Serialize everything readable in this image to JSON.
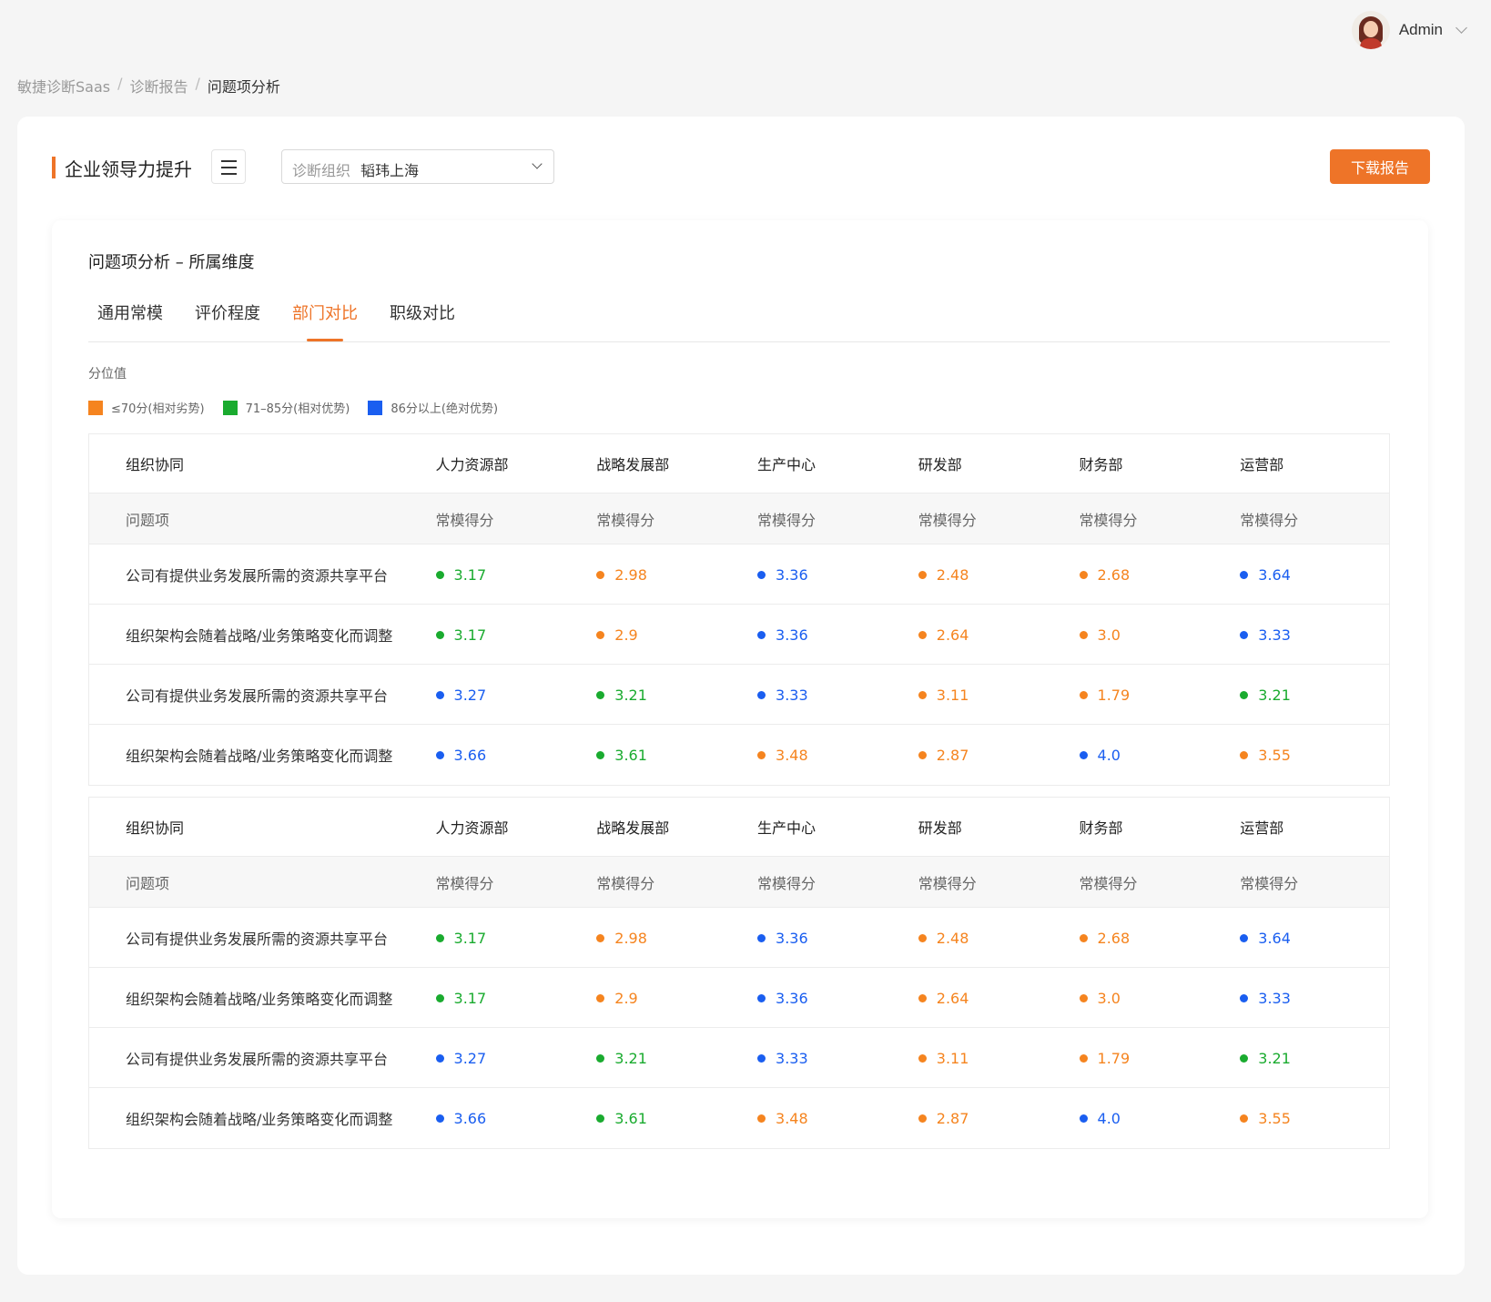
{
  "user": {
    "name": "Admin"
  },
  "breadcrumb": [
    "敏捷诊断Saas",
    "诊断报告",
    "问题项分析"
  ],
  "page": {
    "title": "企业领导力提升",
    "select_label": "诊断组织",
    "select_value": "韬玮上海",
    "download_label": "下载报告"
  },
  "section": {
    "title": "问题项分析 – 所属维度"
  },
  "tabs": [
    {
      "label": "通用常模",
      "active": false
    },
    {
      "label": "评价程度",
      "active": false
    },
    {
      "label": "部门对比",
      "active": true
    },
    {
      "label": "职级对比",
      "active": false
    }
  ],
  "legend": {
    "title": "分位值",
    "items": [
      {
        "label": "≤70分(相对劣势)",
        "color": "#f5841f"
      },
      {
        "label": "71–85分(相对优势)",
        "color": "#1aab2f"
      },
      {
        "label": "86分以上(绝对优势)",
        "color": "#1a5ef0"
      }
    ]
  },
  "colors": {
    "orange": "#f5841f",
    "green": "#1aab2f",
    "blue": "#1a5ef0",
    "accent": "#ee7428"
  },
  "tables": [
    {
      "dimension": "组织协同",
      "departments": [
        "人力资源部",
        "战略发展部",
        "生产中心",
        "研发部",
        "财务部",
        "运营部"
      ],
      "sub_first": "问题项",
      "sub_col": "常模得分",
      "rows": [
        {
          "item": "公司有提供业务发展所需的资源共享平台",
          "scores": [
            {
              "v": "3.17",
              "c": "green"
            },
            {
              "v": "2.98",
              "c": "orange"
            },
            {
              "v": "3.36",
              "c": "blue"
            },
            {
              "v": "2.48",
              "c": "orange"
            },
            {
              "v": "2.68",
              "c": "orange"
            },
            {
              "v": "3.64",
              "c": "blue"
            }
          ]
        },
        {
          "item": "组织架构会随着战略/业务策略变化而调整",
          "scores": [
            {
              "v": "3.17",
              "c": "green"
            },
            {
              "v": "2.9",
              "c": "orange"
            },
            {
              "v": "3.36",
              "c": "blue"
            },
            {
              "v": "2.64",
              "c": "orange"
            },
            {
              "v": "3.0",
              "c": "orange"
            },
            {
              "v": "3.33",
              "c": "blue"
            }
          ]
        },
        {
          "item": "公司有提供业务发展所需的资源共享平台",
          "scores": [
            {
              "v": "3.27",
              "c": "blue"
            },
            {
              "v": "3.21",
              "c": "green"
            },
            {
              "v": "3.33",
              "c": "blue"
            },
            {
              "v": "3.11",
              "c": "orange"
            },
            {
              "v": "1.79",
              "c": "orange"
            },
            {
              "v": "3.21",
              "c": "green"
            }
          ]
        },
        {
          "item": "组织架构会随着战略/业务策略变化而调整",
          "scores": [
            {
              "v": "3.66",
              "c": "blue"
            },
            {
              "v": "3.61",
              "c": "green"
            },
            {
              "v": "3.48",
              "c": "orange"
            },
            {
              "v": "2.87",
              "c": "orange"
            },
            {
              "v": "4.0",
              "c": "blue"
            },
            {
              "v": "3.55",
              "c": "orange"
            }
          ]
        }
      ]
    },
    {
      "dimension": "组织协同",
      "departments": [
        "人力资源部",
        "战略发展部",
        "生产中心",
        "研发部",
        "财务部",
        "运营部"
      ],
      "sub_first": "问题项",
      "sub_col": "常模得分",
      "rows": [
        {
          "item": "公司有提供业务发展所需的资源共享平台",
          "scores": [
            {
              "v": "3.17",
              "c": "green"
            },
            {
              "v": "2.98",
              "c": "orange"
            },
            {
              "v": "3.36",
              "c": "blue"
            },
            {
              "v": "2.48",
              "c": "orange"
            },
            {
              "v": "2.68",
              "c": "orange"
            },
            {
              "v": "3.64",
              "c": "blue"
            }
          ]
        },
        {
          "item": "组织架构会随着战略/业务策略变化而调整",
          "scores": [
            {
              "v": "3.17",
              "c": "green"
            },
            {
              "v": "2.9",
              "c": "orange"
            },
            {
              "v": "3.36",
              "c": "blue"
            },
            {
              "v": "2.64",
              "c": "orange"
            },
            {
              "v": "3.0",
              "c": "orange"
            },
            {
              "v": "3.33",
              "c": "blue"
            }
          ]
        },
        {
          "item": "公司有提供业务发展所需的资源共享平台",
          "scores": [
            {
              "v": "3.27",
              "c": "blue"
            },
            {
              "v": "3.21",
              "c": "green"
            },
            {
              "v": "3.33",
              "c": "blue"
            },
            {
              "v": "3.11",
              "c": "orange"
            },
            {
              "v": "1.79",
              "c": "orange"
            },
            {
              "v": "3.21",
              "c": "green"
            }
          ]
        },
        {
          "item": "组织架构会随着战略/业务策略变化而调整",
          "scores": [
            {
              "v": "3.66",
              "c": "blue"
            },
            {
              "v": "3.61",
              "c": "green"
            },
            {
              "v": "3.48",
              "c": "orange"
            },
            {
              "v": "2.87",
              "c": "orange"
            },
            {
              "v": "4.0",
              "c": "blue"
            },
            {
              "v": "3.55",
              "c": "orange"
            }
          ]
        }
      ]
    }
  ]
}
